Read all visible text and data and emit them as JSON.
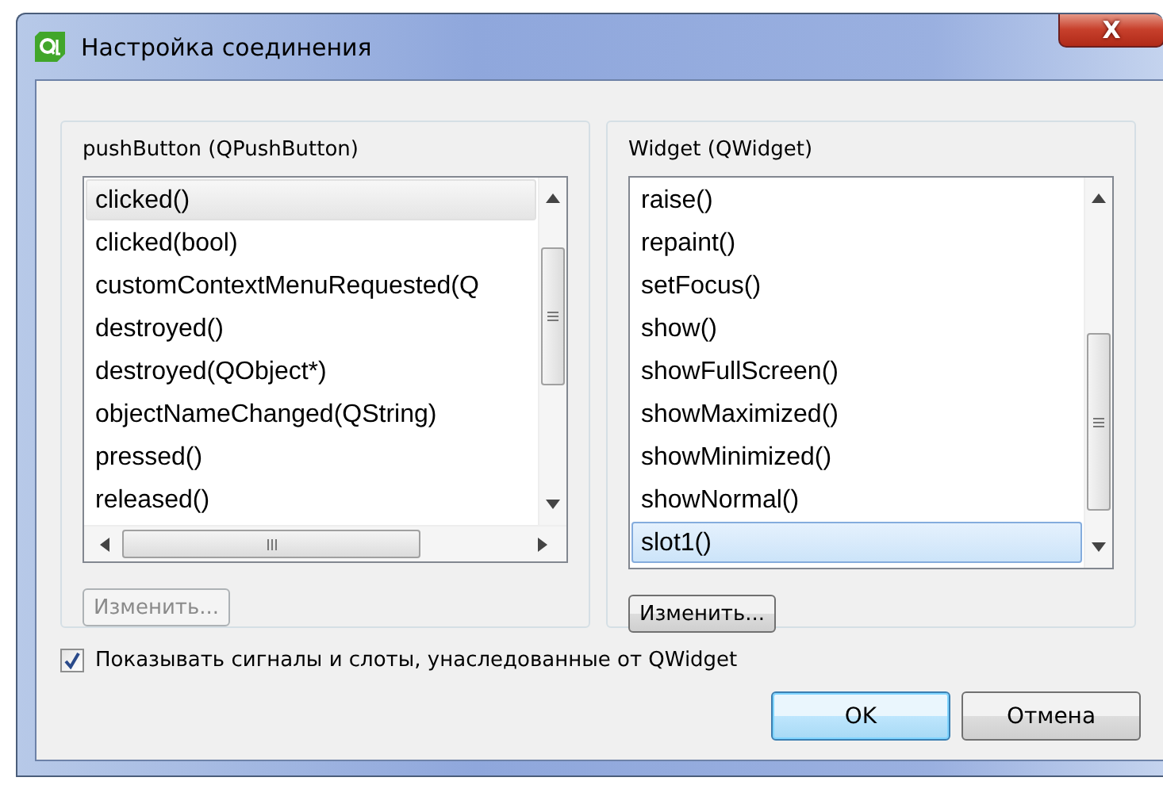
{
  "window": {
    "title": "Настройка соединения",
    "close_label": "X"
  },
  "panels": [
    {
      "title": "pushButton (QPushButton)",
      "active": false,
      "edit_button": {
        "label": "Изменить...",
        "disabled": true
      },
      "items": [
        {
          "label": "clicked()",
          "selected": true
        },
        {
          "label": "clicked(bool)",
          "selected": false
        },
        {
          "label": "customContextMenuRequested(Q",
          "selected": false
        },
        {
          "label": "destroyed()",
          "selected": false
        },
        {
          "label": "destroyed(QObject*)",
          "selected": false
        },
        {
          "label": "objectNameChanged(QString)",
          "selected": false
        },
        {
          "label": "pressed()",
          "selected": false
        },
        {
          "label": "released()",
          "selected": false
        }
      ]
    },
    {
      "title": "Widget (QWidget)",
      "active": true,
      "edit_button": {
        "label": "Изменить...",
        "disabled": false
      },
      "items": [
        {
          "label": "raise()",
          "selected": false
        },
        {
          "label": "repaint()",
          "selected": false
        },
        {
          "label": "setFocus()",
          "selected": false
        },
        {
          "label": "show()",
          "selected": false
        },
        {
          "label": "showFullScreen()",
          "selected": false
        },
        {
          "label": "showMaximized()",
          "selected": false
        },
        {
          "label": "showMinimized()",
          "selected": false
        },
        {
          "label": "showNormal()",
          "selected": false
        },
        {
          "label": "slot1()",
          "selected": true
        }
      ]
    }
  ],
  "inherited_checkbox": {
    "label": "Показывать сигналы и слоты, унаследованные от QWidget",
    "checked": true
  },
  "buttons": [
    {
      "label": "OK",
      "default": true
    },
    {
      "label": "Отмена",
      "default": false
    }
  ]
}
